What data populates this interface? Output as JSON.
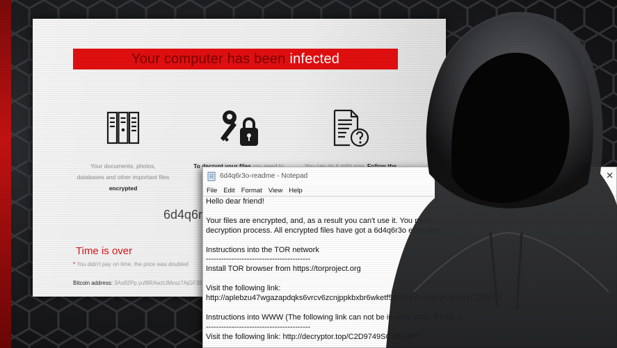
{
  "ransom_page": {
    "banner_text": "Your computer has been",
    "banner_highlight": "infected",
    "features": [
      {
        "icon": "server-files-icon",
        "text_lines": [
          "Your documents, photos,",
          "databases and other important files"
        ],
        "bold": "encrypted"
      },
      {
        "icon": "key-lock-icon",
        "bold": "To decrypt your files",
        "text_lines": [
          "you need to"
        ]
      },
      {
        "icon": "document-question-icon",
        "text_lines": [
          "You can do it right now."
        ],
        "bold": "Follow the"
      }
    ],
    "id_code": "6d4q6r",
    "time_over": "Time is over",
    "time_note_star": "*",
    "time_note": "You didn't pay on time, the price was doubled",
    "bitcoin_label": "Bitcoin address:",
    "bitcoin_value": "3As82Pp.yuf9RAwzUMvsz7AjGF353"
  },
  "notepad": {
    "title": "6d4q6r3o-readme - Notepad",
    "menu": [
      "File",
      "Edit",
      "Format",
      "View",
      "Help"
    ],
    "close_glyph": "✕",
    "content": "Hello dear friend!\n\nYour files are encrypted, and, as a result you can't use it. You must\ndecryption process. All encrypted files have got a 6d4q6r3o extension.\n\nInstructions into the TOR network\n-----------------------------------------\nInstall TOR browser from https://torproject.org\n\nVisit the following link:\nhttp://aplebzu47wgazapdqks6vrcv6zcnjppkbxbr6wketf56nf6aq2nmyoyd.onion/C2D9749\n\nInstructions into WWW (The following link can not be in work state, if true, u\n-----------------------------------------\nVisit the following link: http://decryptor.top/C2D9749SC4BA3647"
  },
  "colors": {
    "banner_red": "#e10f10",
    "time_red": "#d7161a",
    "background": "#1d1e20"
  }
}
